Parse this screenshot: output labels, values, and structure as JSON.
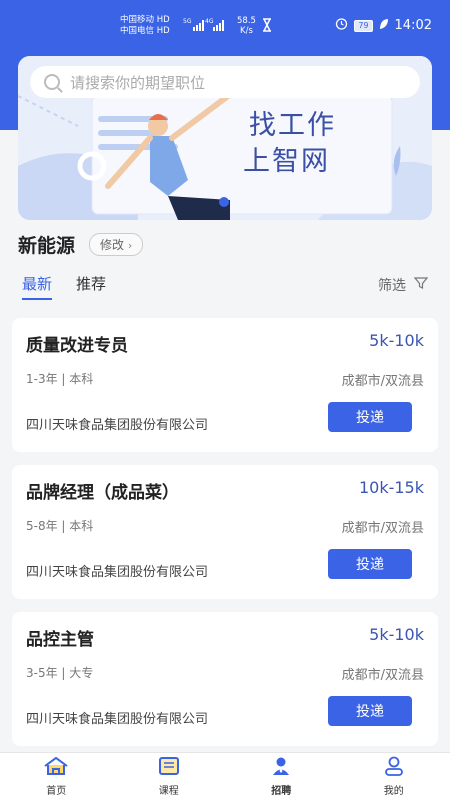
{
  "status_bar": {
    "carrier_1": "中国移动 HD",
    "carrier_2": "中国电信 HD",
    "speed": "58.5",
    "speed_unit": "K/s",
    "signal_1": "5G",
    "signal_2": "4G",
    "battery": "79",
    "time": "14:02"
  },
  "search": {
    "placeholder": "请搜索你的期望职位"
  },
  "banner": {
    "line1": "找工作",
    "line2": "上智网"
  },
  "section": {
    "title": "新能源",
    "edit_label": "修改"
  },
  "tabs": [
    {
      "label": "最新",
      "active": true
    },
    {
      "label": "推荐",
      "active": false
    }
  ],
  "filter": {
    "label": "筛选"
  },
  "jobs": [
    {
      "title": "质量改进专员",
      "salary": "5k-10k",
      "requirements": "1-3年 | 本科",
      "location": "成都市/双流县",
      "company": "四川天味食品集团股份有限公司",
      "apply_label": "投递"
    },
    {
      "title": "品牌经理（成品菜）",
      "salary": "10k-15k",
      "requirements": "5-8年 | 本科",
      "location": "成都市/双流县",
      "company": "四川天味食品集团股份有限公司",
      "apply_label": "投递"
    },
    {
      "title": "品控主管",
      "salary": "5k-10k",
      "requirements": "3-5年 | 大专",
      "location": "成都市/双流县",
      "company": "四川天味食品集团股份有限公司",
      "apply_label": "投递"
    }
  ],
  "tabbar": [
    {
      "label": "首页",
      "icon": "home-icon"
    },
    {
      "label": "课程",
      "icon": "book-icon"
    },
    {
      "label": "招聘",
      "icon": "recruit-icon"
    },
    {
      "label": "我的",
      "icon": "user-icon"
    }
  ],
  "colors": {
    "primary": "#3a63e6",
    "salary": "#3a55b4",
    "background": "#f4f5f7"
  }
}
